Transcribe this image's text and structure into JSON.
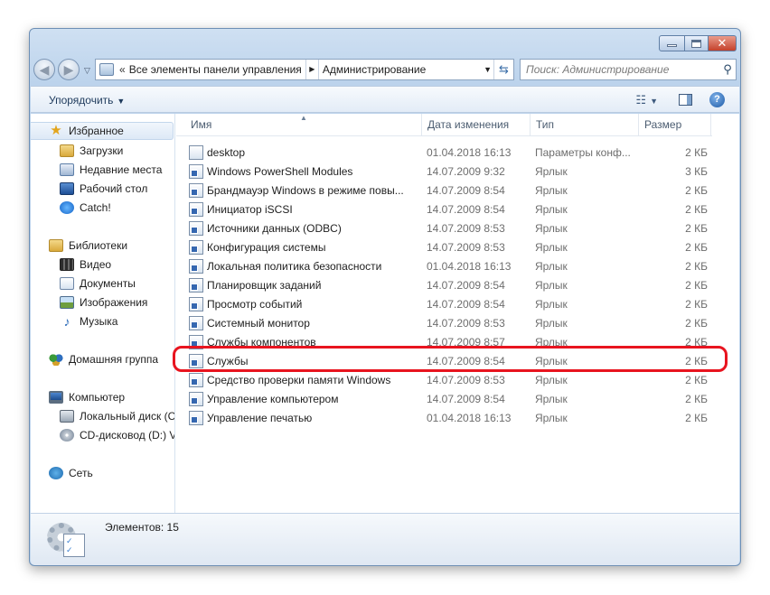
{
  "address": {
    "overflow": "«",
    "crumbs": [
      "Все элементы панели управления",
      "Администрирование"
    ],
    "search_placeholder": "Поиск: Администрирование"
  },
  "toolbar": {
    "organize_label": "Упорядочить"
  },
  "sidebar": {
    "favorites": {
      "label": "Избранное",
      "items": [
        "Загрузки",
        "Недавние места",
        "Рабочий стол",
        "Catch!"
      ]
    },
    "libraries": {
      "label": "Библиотеки",
      "items": [
        "Видео",
        "Документы",
        "Изображения",
        "Музыка"
      ]
    },
    "homegroup": {
      "label": "Домашняя группа"
    },
    "computer": {
      "label": "Компьютер",
      "items": [
        "Локальный диск (C",
        "CD-дисковод (D:) Vi"
      ]
    },
    "network": {
      "label": "Сеть"
    }
  },
  "columns": {
    "name": "Имя",
    "date": "Дата изменения",
    "type": "Тип",
    "size": "Размер"
  },
  "files": [
    {
      "name": "desktop",
      "date": "01.04.2018 16:13",
      "type": "Параметры конф...",
      "size": "2 КБ"
    },
    {
      "name": "Windows PowerShell Modules",
      "date": "14.07.2009 9:32",
      "type": "Ярлык",
      "size": "3 КБ"
    },
    {
      "name": "Брандмауэр Windows в режиме повы...",
      "date": "14.07.2009 8:54",
      "type": "Ярлык",
      "size": "2 КБ"
    },
    {
      "name": "Инициатор iSCSI",
      "date": "14.07.2009 8:54",
      "type": "Ярлык",
      "size": "2 КБ"
    },
    {
      "name": "Источники данных (ODBC)",
      "date": "14.07.2009 8:53",
      "type": "Ярлык",
      "size": "2 КБ"
    },
    {
      "name": "Конфигурация системы",
      "date": "14.07.2009 8:53",
      "type": "Ярлык",
      "size": "2 КБ"
    },
    {
      "name": "Локальная политика безопасности",
      "date": "01.04.2018 16:13",
      "type": "Ярлык",
      "size": "2 КБ"
    },
    {
      "name": "Планировщик заданий",
      "date": "14.07.2009 8:54",
      "type": "Ярлык",
      "size": "2 КБ"
    },
    {
      "name": "Просмотр событий",
      "date": "14.07.2009 8:54",
      "type": "Ярлык",
      "size": "2 КБ"
    },
    {
      "name": "Системный монитор",
      "date": "14.07.2009 8:53",
      "type": "Ярлык",
      "size": "2 КБ"
    },
    {
      "name": "Службы компонентов",
      "date": "14.07.2009 8:57",
      "type": "Ярлык",
      "size": "2 КБ"
    },
    {
      "name": "Службы",
      "date": "14.07.2009 8:54",
      "type": "Ярлык",
      "size": "2 КБ"
    },
    {
      "name": "Средство проверки памяти Windows",
      "date": "14.07.2009 8:53",
      "type": "Ярлык",
      "size": "2 КБ"
    },
    {
      "name": "Управление компьютером",
      "date": "14.07.2009 8:54",
      "type": "Ярлык",
      "size": "2 КБ"
    },
    {
      "name": "Управление печатью",
      "date": "01.04.2018 16:13",
      "type": "Ярлык",
      "size": "2 КБ"
    }
  ],
  "details": {
    "items_count": "Элементов: 15"
  }
}
